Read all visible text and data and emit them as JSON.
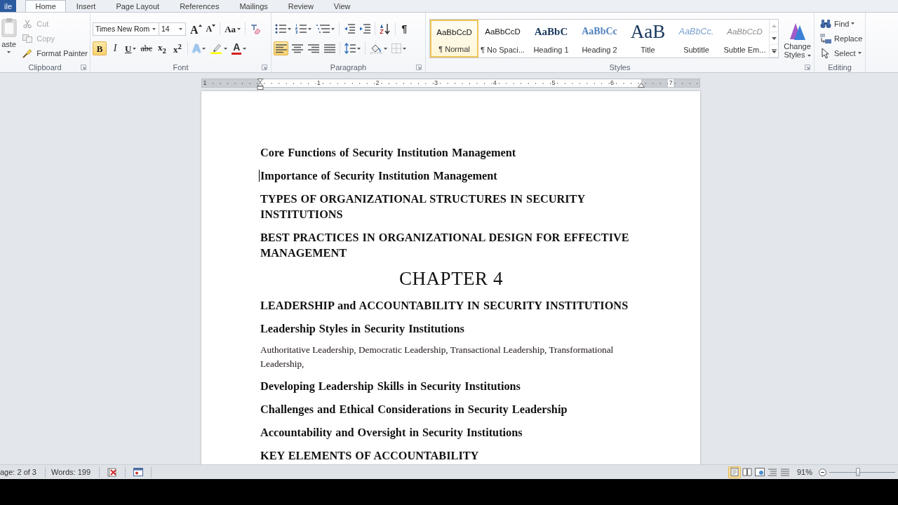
{
  "tabs": [
    {
      "label": "ile",
      "kind": "file",
      "selected": false
    },
    {
      "label": "Home",
      "kind": "tab",
      "selected": true
    },
    {
      "label": "Insert",
      "kind": "tab",
      "selected": false
    },
    {
      "label": "Page Layout",
      "kind": "tab",
      "selected": false
    },
    {
      "label": "References",
      "kind": "tab",
      "selected": false
    },
    {
      "label": "Mailings",
      "kind": "tab",
      "selected": false
    },
    {
      "label": "Review",
      "kind": "tab",
      "selected": false
    },
    {
      "label": "View",
      "kind": "tab",
      "selected": false
    }
  ],
  "clipboard": {
    "paste": "aste",
    "commands": [
      {
        "kind": "cut",
        "label": "Cut",
        "disabled": true
      },
      {
        "kind": "copy",
        "label": "Copy",
        "disabled": true
      },
      {
        "kind": "painter",
        "label": "Format Painter",
        "disabled": false
      }
    ],
    "label": "Clipboard"
  },
  "font": {
    "name": "Times New Rom",
    "size": "14",
    "size_tools": [
      {
        "kind": "grow",
        "glyph": "A"
      },
      {
        "kind": "shrink",
        "glyph": "A"
      },
      {
        "kind": "case",
        "glyph": "Aa"
      },
      {
        "kind": "clear"
      }
    ],
    "toggles": [
      {
        "kind": "bold",
        "glyph": "B",
        "selected": true
      },
      {
        "kind": "italic",
        "glyph": "I",
        "selected": false
      },
      {
        "kind": "underline",
        "glyph": "U",
        "selected": false
      },
      {
        "kind": "strike",
        "glyph": "abc",
        "selected": false
      },
      {
        "kind": "subscript",
        "glyph": "x$_{2}$",
        "selected": false
      },
      {
        "kind": "superscript",
        "glyph": "x$^{2}$",
        "selected": false
      }
    ],
    "effects": [
      {
        "kind": "effects",
        "glyph": "A"
      },
      {
        "kind": "highlight"
      },
      {
        "kind": "color",
        "glyph": "A"
      }
    ],
    "label": "Font"
  },
  "paragraph": {
    "lists": [
      {
        "kind": "bullets"
      },
      {
        "kind": "numbering"
      },
      {
        "kind": "multilevel"
      },
      {
        "kind": "outdent"
      },
      {
        "kind": "indent"
      },
      {
        "kind": "sort"
      },
      {
        "kind": "marks",
        "glyph": "¶"
      }
    ],
    "alignment": [
      {
        "kind": "left",
        "selected": true
      },
      {
        "kind": "center",
        "selected": false
      },
      {
        "kind": "right",
        "selected": false
      },
      {
        "kind": "justify",
        "selected": false
      }
    ],
    "tools": [
      {
        "kind": "spacing"
      },
      {
        "kind": "shading"
      },
      {
        "kind": "borders"
      }
    ],
    "label": "Paragraph"
  },
  "styles": {
    "gallery": [
      {
        "kind": "normal",
        "sample": "AaBbCcD",
        "name": "¶ Normal",
        "selected": true
      },
      {
        "kind": "nospacing",
        "sample": "AaBbCcD",
        "name": "¶ No Spaci...",
        "selected": false
      },
      {
        "kind": "heading1",
        "sample": "AaBbC",
        "name": "Heading 1",
        "selected": false
      },
      {
        "kind": "heading2",
        "sample": "AaBbCc",
        "name": "Heading 2",
        "selected": false
      },
      {
        "kind": "title",
        "sample": "AaB",
        "name": "Title",
        "selected": false
      },
      {
        "kind": "subtitle",
        "sample": "AaBbCc.",
        "name": "Subtitle",
        "selected": false
      },
      {
        "kind": "emphasis",
        "sample": "AaBbCcD",
        "name": "Subtle Em...",
        "selected": false
      }
    ],
    "change": "Change Styles",
    "label": "Styles"
  },
  "editing": {
    "commands": [
      {
        "kind": "find",
        "label": "Find",
        "menu": true
      },
      {
        "kind": "replace",
        "label": "Replace",
        "menu": false
      },
      {
        "kind": "select",
        "label": "Select",
        "menu": true
      }
    ],
    "label": "Editing"
  },
  "ruler": {
    "numbers": [
      "1",
      "1",
      "2",
      "3",
      "4",
      "5",
      "6",
      "7"
    ]
  },
  "document": [
    {
      "kind": "heading",
      "text": "Core Functions of Security Institution Management",
      "cursor": false
    },
    {
      "kind": "heading",
      "text": "Importance of Security Institution Management",
      "cursor": true
    },
    {
      "kind": "heading",
      "text": "TYPES OF ORGANIZATIONAL STRUCTURES IN SECURITY INSTITUTIONS",
      "cursor": false
    },
    {
      "kind": "heading",
      "text": "BEST PRACTICES IN ORGANIZATIONAL DESIGN FOR EFFECTIVE MANAGEMENT",
      "cursor": false
    },
    {
      "kind": "chapter",
      "text": "CHAPTER 4",
      "cursor": false
    },
    {
      "kind": "heading",
      "text": "LEADERSHIP and ACCOUNTABILITY IN SECURITY INSTITUTIONS",
      "cursor": false
    },
    {
      "kind": "heading",
      "text": "Leadership Styles in Security Institutions",
      "cursor": false
    },
    {
      "kind": "body",
      "text": "Authoritative Leadership, Democratic Leadership, Transactional Leadership, Transformational Leadership,",
      "cursor": false
    },
    {
      "kind": "heading",
      "text": "Developing Leadership Skills in Security Institutions",
      "cursor": false
    },
    {
      "kind": "heading",
      "text": "Challenges and Ethical Considerations in Security Leadership",
      "cursor": false
    },
    {
      "kind": "heading",
      "text": "Accountability and Oversight in Security Institutions",
      "cursor": false
    },
    {
      "kind": "heading",
      "text": "KEY ELEMENTS OF ACCOUNTABILITY",
      "cursor": false
    }
  ],
  "status": {
    "page": "age: 2 of 3",
    "words": "Words: 199",
    "views": [
      {
        "kind": "print",
        "selected": true
      },
      {
        "kind": "reading",
        "selected": false
      },
      {
        "kind": "web",
        "selected": false
      },
      {
        "kind": "outline",
        "selected": false
      },
      {
        "kind": "draft",
        "selected": false
      }
    ],
    "zoom": "91%",
    "zoom_slider": {
      "level": 0.44
    }
  }
}
